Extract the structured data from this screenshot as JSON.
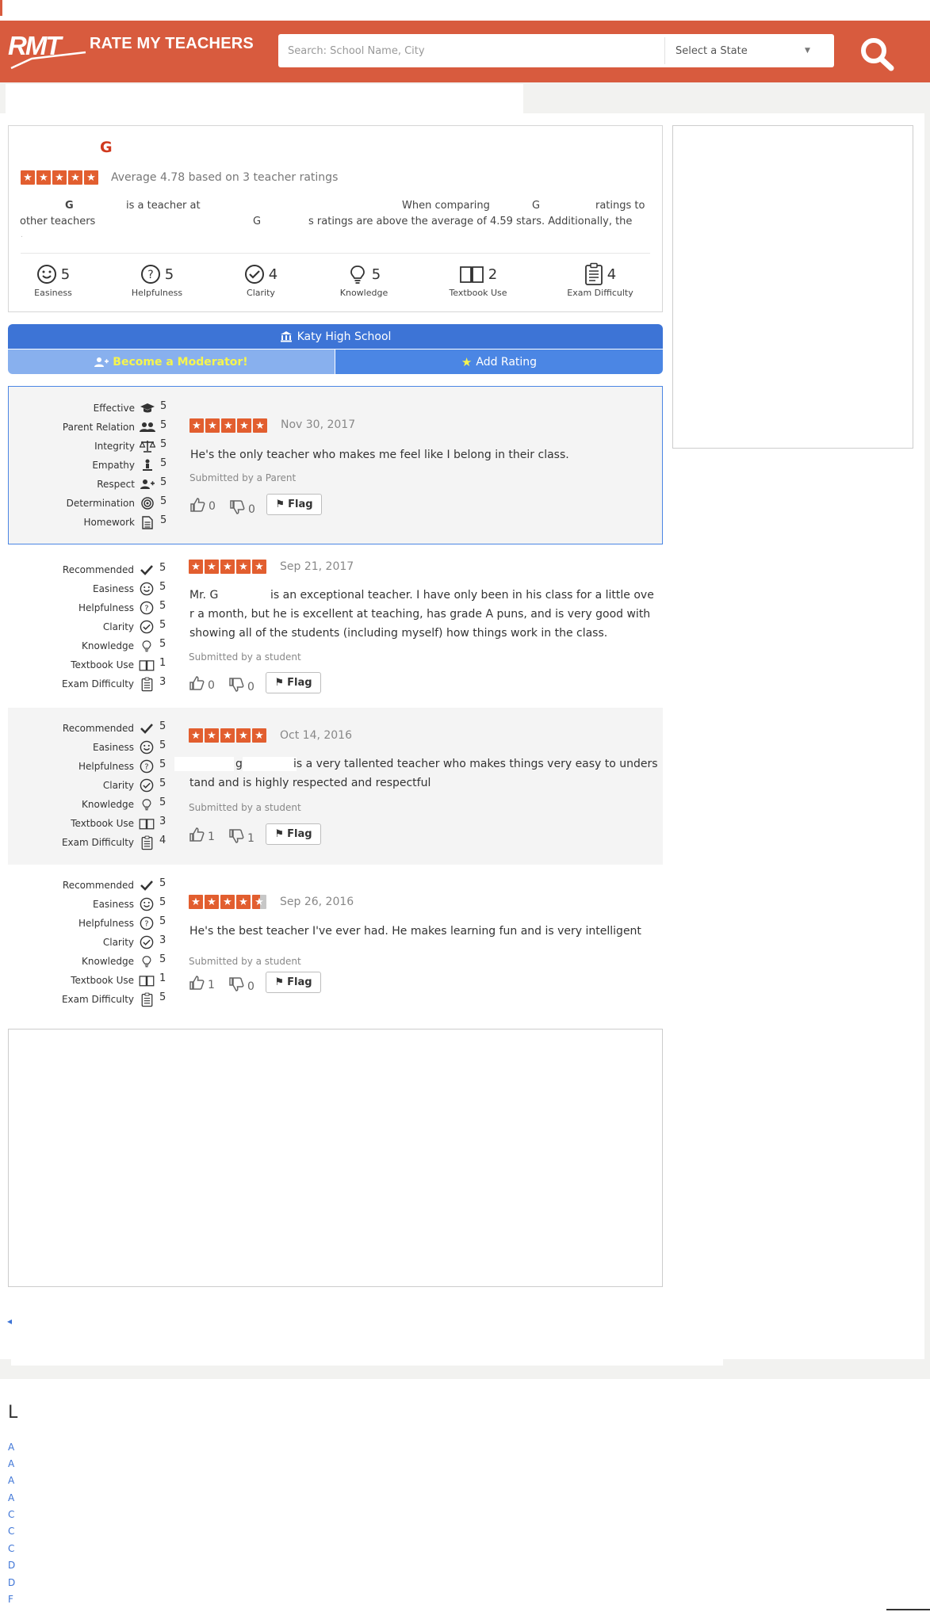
{
  "header": {
    "logo_mark": "RMT",
    "logo_text": "RATE MY TEACHERS",
    "search_placeholder": "Search: School Name, City",
    "state_select": "Select a State",
    "state_caret": "▼",
    "search_button_icon": "search-icon"
  },
  "teacher": {
    "name_initial": "G",
    "rating": 4.78,
    "stars_filled": 5,
    "average_text": "Average 4.78 based on 3 teacher ratings",
    "description": {
      "line1": [
        {
          "text": "G"
        },
        {
          "text": "is a teacher at"
        },
        {
          "text": "When comparing"
        },
        {
          "text": "G"
        },
        {
          "text": "ratings to"
        }
      ],
      "line2": [
        {
          "text": "other teachers"
        },
        {
          "text": "G"
        },
        {
          "text": "s ratings are above the average of 4.59 stars. Additionally, the"
        }
      ],
      "line3": "."
    },
    "metrics": [
      {
        "label": "Easiness",
        "value": "5",
        "icon": "smiley-icon"
      },
      {
        "label": "Helpfulness",
        "value": "5",
        "icon": "question-icon"
      },
      {
        "label": "Clarity",
        "value": "4",
        "icon": "check-circle-icon"
      },
      {
        "label": "Knowledge",
        "value": "5",
        "icon": "lightbulb-icon"
      },
      {
        "label": "Textbook Use",
        "value": "2",
        "icon": "book-icon"
      },
      {
        "label": "Exam Difficulty",
        "value": "4",
        "icon": "clipboard-icon"
      }
    ]
  },
  "school": {
    "name": "Katy High School",
    "icon": "school-icon"
  },
  "actions": {
    "moderator_label": "Become a Moderator!",
    "add_rating_label": "Add Rating"
  },
  "reviews": [
    {
      "categories": [
        {
          "label": "Effective",
          "value": "5",
          "icon": "graduation-cap-icon"
        },
        {
          "label": "Parent Relation",
          "value": "5",
          "icon": "users-icon"
        },
        {
          "label": "Integrity",
          "value": "5",
          "icon": "balance-scale-icon"
        },
        {
          "label": "Empathy",
          "value": "5",
          "icon": "person-icon"
        },
        {
          "label": "Respect",
          "value": "5",
          "icon": "user-plus-icon"
        },
        {
          "label": "Determination",
          "value": "5",
          "icon": "target-icon"
        },
        {
          "label": "Homework",
          "value": "5",
          "icon": "document-icon"
        }
      ],
      "stars": 5,
      "date": "Nov 30, 2017",
      "text_lines": [
        "He's the only teacher who makes me feel like I belong in their class."
      ],
      "submitted_by": "Submitted by a Parent",
      "thumbs_up": "0",
      "thumbs_down": "0",
      "flag_label": "Flag"
    },
    {
      "categories": [
        {
          "label": "Recommended",
          "value": "5",
          "icon": "check-icon"
        },
        {
          "label": "Easiness",
          "value": "5",
          "icon": "smiley-icon"
        },
        {
          "label": "Helpfulness",
          "value": "5",
          "icon": "question-icon"
        },
        {
          "label": "Clarity",
          "value": "5",
          "icon": "check-circle-icon"
        },
        {
          "label": "Knowledge",
          "value": "5",
          "icon": "lightbulb-icon"
        },
        {
          "label": "Textbook Use",
          "value": "1",
          "icon": "book-icon"
        },
        {
          "label": "Exam Difficulty",
          "value": "3",
          "icon": "clipboard-icon"
        }
      ],
      "stars": 5,
      "date": "Sep 21, 2017",
      "text_lines": [
        "Mr. G",
        "is an exceptional teacher. I have only been in his class for a little ove",
        "r a month, but he is excellent at teaching, has grade A puns, and is very good with",
        "showing all of the students (including myself) how things work in the class."
      ],
      "submitted_by": "Submitted by a student",
      "thumbs_up": "0",
      "thumbs_down": "0",
      "flag_label": "Flag"
    },
    {
      "categories": [
        {
          "label": "Recommended",
          "value": "5",
          "icon": "check-icon"
        },
        {
          "label": "Easiness",
          "value": "5",
          "icon": "smiley-icon"
        },
        {
          "label": "Helpfulness",
          "value": "5",
          "icon": "question-icon"
        },
        {
          "label": "Clarity",
          "value": "5",
          "icon": "check-circle-icon"
        },
        {
          "label": "Knowledge",
          "value": "5",
          "icon": "lightbulb-icon"
        },
        {
          "label": "Textbook Use",
          "value": "3",
          "icon": "book-icon"
        },
        {
          "label": "Exam Difficulty",
          "value": "4",
          "icon": "clipboard-icon"
        }
      ],
      "stars": 5,
      "date": "Oct 14, 2016",
      "text_lines": [
        "g",
        "is a very tallented teacher who makes things very easy to unders",
        "tand and is highly respected and respectful"
      ],
      "submitted_by": "Submitted by a student",
      "thumbs_up": "1",
      "thumbs_down": "1",
      "flag_label": "Flag"
    },
    {
      "categories": [
        {
          "label": "Recommended",
          "value": "5",
          "icon": "check-icon"
        },
        {
          "label": "Easiness",
          "value": "5",
          "icon": "smiley-icon"
        },
        {
          "label": "Helpfulness",
          "value": "5",
          "icon": "question-icon"
        },
        {
          "label": "Clarity",
          "value": "3",
          "icon": "check-circle-icon"
        },
        {
          "label": "Knowledge",
          "value": "5",
          "icon": "lightbulb-icon"
        },
        {
          "label": "Textbook Use",
          "value": "1",
          "icon": "book-icon"
        },
        {
          "label": "Exam Difficulty",
          "value": "5",
          "icon": "clipboard-icon"
        }
      ],
      "stars": 4.5,
      "date": "Sep 26, 2016",
      "text_lines": [
        "He's the best teacher I've ever had. He makes learning fun and is very intelligent"
      ],
      "submitted_by": "Submitted by a student",
      "thumbs_up": "1",
      "thumbs_down": "0",
      "flag_label": "Flag"
    }
  ],
  "pagination": {
    "prev_icon": "◂"
  },
  "footer": {
    "heading": "L",
    "links": [
      "A",
      "A",
      "A",
      "A",
      "C",
      "C",
      "C",
      "D",
      "D",
      "F"
    ]
  },
  "colors": {
    "brand": "#d85b3e",
    "star": "#e25e2f",
    "school_bar": "#3d74d6",
    "moderator_button": "#88b0ee",
    "moderator_text": "#f6f54d",
    "add_rating_button": "#4b86e4"
  }
}
